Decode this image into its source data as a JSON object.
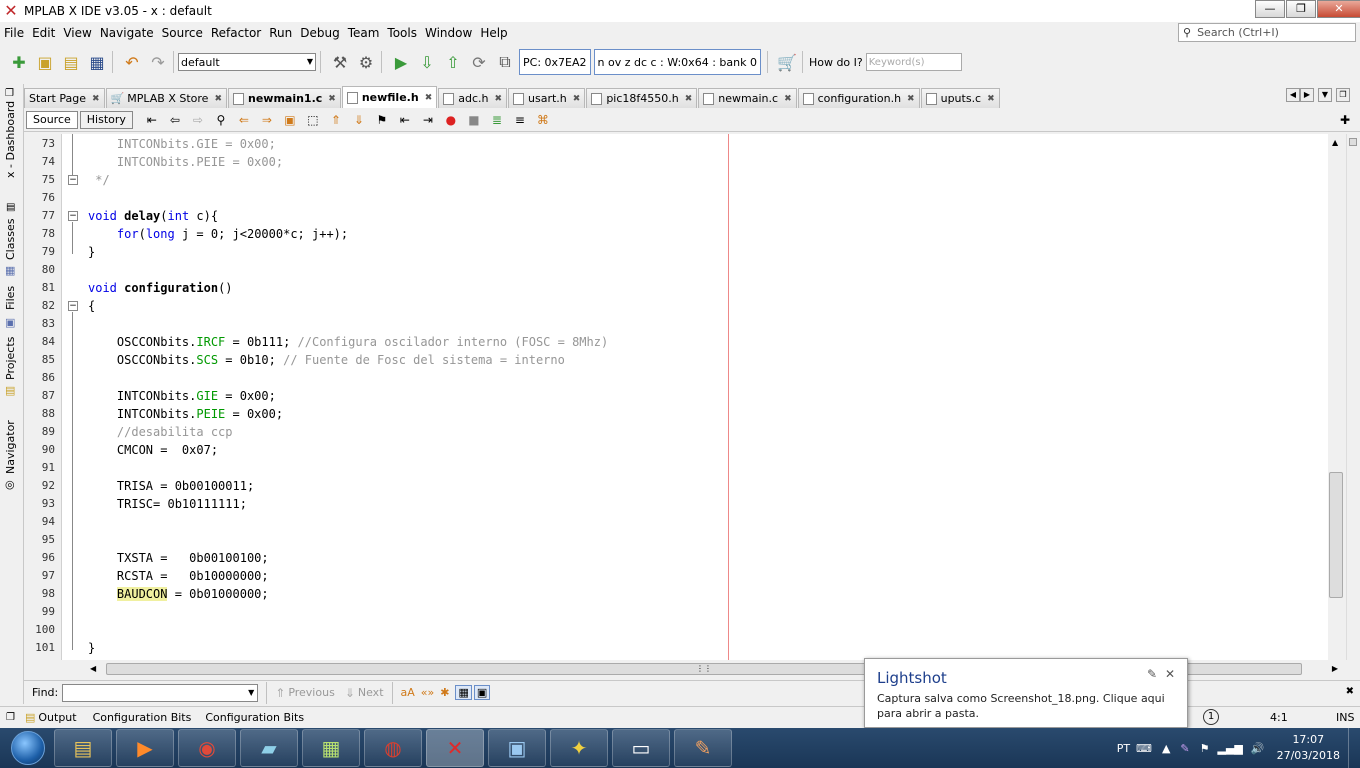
{
  "window": {
    "title": "MPLAB X IDE v3.05 - x : default",
    "min": "—",
    "max": "❐",
    "close": "✕"
  },
  "menu": [
    "File",
    "Edit",
    "View",
    "Navigate",
    "Source",
    "Refactor",
    "Run",
    "Debug",
    "Team",
    "Tools",
    "Window",
    "Help"
  ],
  "search": {
    "placeholder": "Search (Ctrl+I)"
  },
  "toolbar": {
    "config": "default",
    "pc": "PC: 0x7EA2",
    "status": "n ov z dc c  : W:0x64 : bank 0",
    "howdoi": "How do I?",
    "keyword_placeholder": "Keyword(s)"
  },
  "side_panels": [
    "x - Dashboard",
    "Classes",
    "Files",
    "Projects",
    "Navigator"
  ],
  "tabs": [
    "Start Page",
    "MPLAB X Store",
    "newmain1.c",
    "newfile.h",
    "adc.h",
    "usart.h",
    "pic18f4550.h",
    "newmain.c",
    "configuration.h",
    "uputs.c"
  ],
  "editor": {
    "source": "Source",
    "history": "History"
  },
  "lines": [
    {
      "n": "73",
      "code": "    INTCONbits.GIE = 0x00;"
    },
    {
      "n": "74",
      "code": "    INTCONbits.PEIE = 0x00;"
    },
    {
      "n": "75",
      "code": " */"
    },
    {
      "n": "76",
      "code": ""
    },
    {
      "n": "77",
      "code": "void delay(int c){"
    },
    {
      "n": "78",
      "code": "    for(long j = 0; j<20000*c; j++);"
    },
    {
      "n": "79",
      "code": "}"
    },
    {
      "n": "80",
      "code": ""
    },
    {
      "n": "81",
      "code": "void configuration()"
    },
    {
      "n": "82",
      "code": "{"
    },
    {
      "n": "83",
      "code": ""
    },
    {
      "n": "84",
      "code": "    OSCCONbits.IRCF = 0b111; //Configura oscilador interno (FOSC = 8Mhz)"
    },
    {
      "n": "85",
      "code": "    OSCCONbits.SCS = 0b10; // Fuente de Fosc del sistema = interno"
    },
    {
      "n": "86",
      "code": ""
    },
    {
      "n": "87",
      "code": "    INTCONbits.GIE = 0x00;"
    },
    {
      "n": "88",
      "code": "    INTCONbits.PEIE = 0x00;"
    },
    {
      "n": "89",
      "code": "    //desabilita ccp"
    },
    {
      "n": "90",
      "code": "    CMCON =  0x07;"
    },
    {
      "n": "91",
      "code": ""
    },
    {
      "n": "92",
      "code": "    TRISA = 0b00100011;"
    },
    {
      "n": "93",
      "code": "    TRISC= 0b10111111;"
    },
    {
      "n": "94",
      "code": ""
    },
    {
      "n": "95",
      "code": ""
    },
    {
      "n": "96",
      "code": "    TXSTA =   0b00100100;"
    },
    {
      "n": "97",
      "code": "    RCSTA =   0b10000000;"
    },
    {
      "n": "98",
      "code": "    BAUDCON = 0b01000000;"
    },
    {
      "n": "99",
      "code": ""
    },
    {
      "n": "100",
      "code": ""
    },
    {
      "n": "101",
      "code": "}"
    }
  ],
  "find": {
    "label": "Find:",
    "previous": "Previous",
    "next": "Next"
  },
  "bottom": {
    "output": "Output",
    "cfg1": "Configuration Bits",
    "cfg2": "Configuration Bits",
    "pos": "4:1",
    "ins": "INS",
    "notif": "1"
  },
  "toast": {
    "title": "Lightshot",
    "body": "Captura salva como Screenshot_18.png. Clique aqui para abrir a pasta."
  },
  "tray": {
    "lang": "PT",
    "time": "17:07",
    "date": "27/03/2018"
  }
}
